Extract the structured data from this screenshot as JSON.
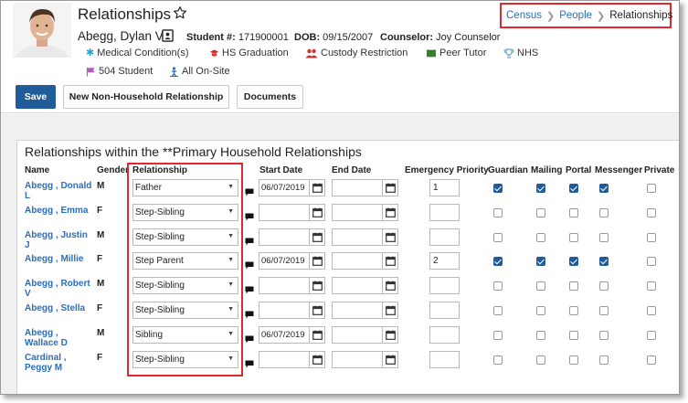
{
  "header": {
    "title": "Relationships",
    "student_name": "Abegg, Dylan V",
    "student_num_label": "Student #:",
    "student_num": "171900001",
    "dob_label": "DOB:",
    "dob": "09/15/2007",
    "counselor_label": "Counselor:",
    "counselor": "Joy Counselor",
    "flags": [
      {
        "label": "Medical Condition(s)",
        "icon": "asterisk-icon",
        "color": "#29a3d6"
      },
      {
        "label": "HS Graduation",
        "icon": "graduation-icon",
        "color": "#d0312d"
      },
      {
        "label": "Custody Restriction",
        "icon": "users-icon",
        "color": "#d0312d"
      },
      {
        "label": "Peer Tutor",
        "icon": "book-icon",
        "color": "#3a7d2c"
      },
      {
        "label": "NHS",
        "icon": "trophy-icon",
        "color": "#6aa6c8"
      },
      {
        "label": "504 Student",
        "icon": "flag-icon",
        "color": "#b05fb8"
      },
      {
        "label": "All On-Site",
        "icon": "person-icon",
        "color": "#2a6ebb"
      }
    ]
  },
  "breadcrumb": {
    "items": [
      "Census",
      "People"
    ],
    "current": "Relationships"
  },
  "toolbar": {
    "save": "Save",
    "new_relationship": "New Non-Household Relationship",
    "documents": "Documents"
  },
  "panel": {
    "title": "Relationships within the **Primary Household Relationships"
  },
  "table": {
    "headers": {
      "name": "Name",
      "gender": "Gender",
      "relationship": "Relationship",
      "start_date": "Start Date",
      "end_date": "End Date",
      "emergency_priority": "Emergency Priority",
      "guardian": "Guardian",
      "mailing": "Mailing",
      "portal": "Portal",
      "messenger": "Messenger",
      "private": "Private"
    },
    "rows": [
      {
        "name": "Abegg , Donald L",
        "gender": "M",
        "relationship": "Father",
        "start_date": "06/07/2019",
        "end_date": "",
        "priority": "1",
        "guardian": true,
        "mailing": true,
        "portal": true,
        "messenger": true,
        "private": false
      },
      {
        "name": "Abegg , Emma",
        "gender": "F",
        "relationship": "Step-Sibling",
        "start_date": "",
        "end_date": "",
        "priority": "",
        "guardian": false,
        "mailing": false,
        "portal": false,
        "messenger": false,
        "private": false
      },
      {
        "name": "Abegg , Justin J",
        "gender": "M",
        "relationship": "Step-Sibling",
        "start_date": "",
        "end_date": "",
        "priority": "",
        "guardian": false,
        "mailing": false,
        "portal": false,
        "messenger": false,
        "private": false
      },
      {
        "name": "Abegg , Millie",
        "gender": "F",
        "relationship": "Step Parent",
        "start_date": "06/07/2019",
        "end_date": "",
        "priority": "2",
        "guardian": true,
        "mailing": true,
        "portal": true,
        "messenger": true,
        "private": false
      },
      {
        "name": "Abegg , Robert V",
        "gender": "M",
        "relationship": "Step-Sibling",
        "start_date": "",
        "end_date": "",
        "priority": "",
        "guardian": false,
        "mailing": false,
        "portal": false,
        "messenger": false,
        "private": false
      },
      {
        "name": "Abegg , Stella",
        "gender": "F",
        "relationship": "Step-Sibling",
        "start_date": "",
        "end_date": "",
        "priority": "",
        "guardian": false,
        "mailing": false,
        "portal": false,
        "messenger": false,
        "private": false
      },
      {
        "name": "Abegg , Wallace D",
        "gender": "M",
        "relationship": "Sibling",
        "start_date": "06/07/2019",
        "end_date": "",
        "priority": "",
        "guardian": false,
        "mailing": false,
        "portal": false,
        "messenger": false,
        "private": false
      },
      {
        "name": "Cardinal , Peggy M",
        "gender": "F",
        "relationship": "Step-Sibling",
        "start_date": "",
        "end_date": "",
        "priority": "",
        "guardian": false,
        "mailing": false,
        "portal": false,
        "messenger": false,
        "private": false
      }
    ]
  }
}
